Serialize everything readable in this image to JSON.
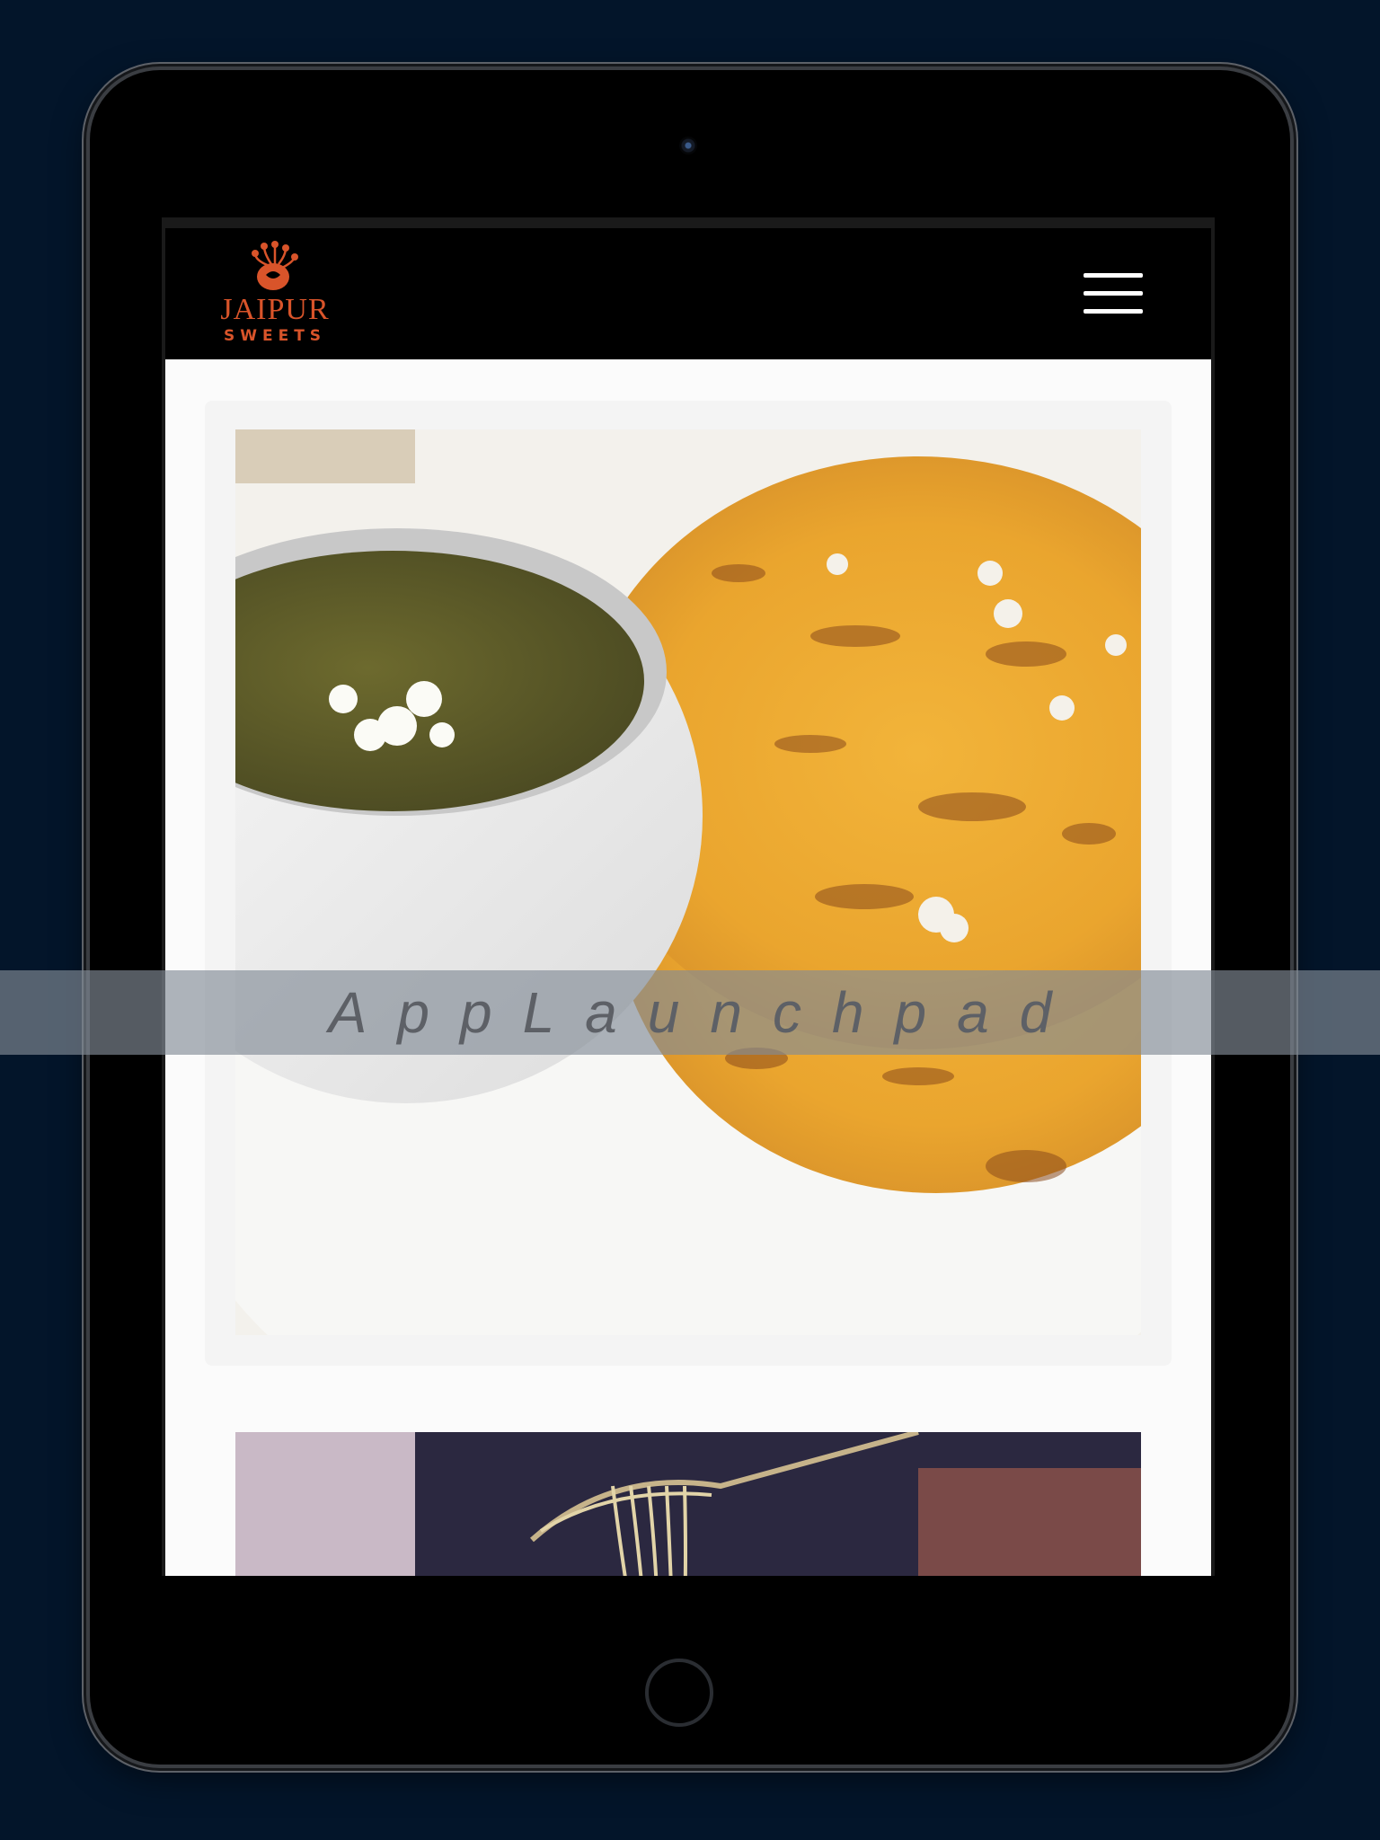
{
  "header": {
    "logo_title": "JAIPUR",
    "logo_subtitle": "SWEETS",
    "menu_icon": "hamburger-menu-icon"
  },
  "content": {
    "cards": [
      {
        "image": "saag-and-makki-roti"
      },
      {
        "image": "noodles-on-fork"
      }
    ]
  },
  "watermark": {
    "text": "AppLaunchpad"
  },
  "colors": {
    "background": "#03152a",
    "brand": "#d9542a",
    "header": "#000000"
  }
}
